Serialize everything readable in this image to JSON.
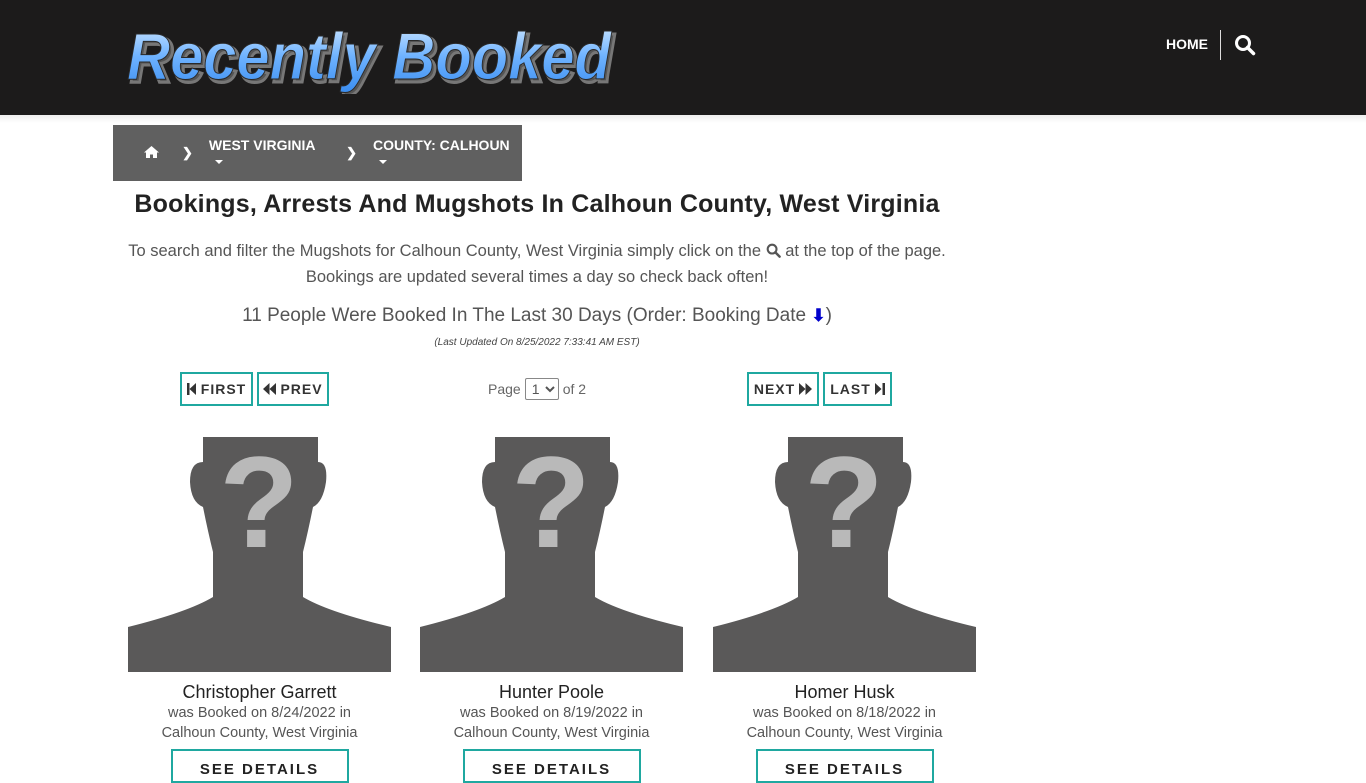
{
  "header": {
    "logo_text": "Recently Booked",
    "nav_home": "HOME",
    "search_icon": "search-icon"
  },
  "breadcrumb": {
    "home_icon": "home-icon",
    "state": "WEST VIRGINIA",
    "county": "COUNTY: CALHOUN"
  },
  "main": {
    "title": "Bookings, Arrests And Mugshots In Calhoun County, West Virginia",
    "intro_before": "To search and filter the Mugshots for Calhoun County, West Virginia simply click on the",
    "intro_after": "at the top of the page.",
    "intro_line2": "Bookings are updated several times a day so check back often!",
    "count_text": "11 People Were Booked In The Last 30 Days (Order: Booking Date",
    "count_close": ")",
    "last_updated": "(Last Updated On 8/25/2022 7:33:41 AM EST)"
  },
  "pager": {
    "first": "FIRST",
    "prev": "PREV",
    "page_label": "Page",
    "page_value": "1",
    "of_label": "of 2",
    "next": "NEXT",
    "last": "LAST"
  },
  "people": [
    {
      "name": "Christopher Garrett",
      "booked": "was Booked on 8/24/2022 in",
      "location": "Calhoun County, West Virginia",
      "button": "SEE DETAILS"
    },
    {
      "name": "Hunter Poole",
      "booked": "was Booked on 8/19/2022 in",
      "location": "Calhoun County, West Virginia",
      "button": "SEE DETAILS"
    },
    {
      "name": "Homer Husk",
      "booked": "was Booked on 8/18/2022 in",
      "location": "Calhoun County, West Virginia",
      "button": "SEE DETAILS"
    }
  ]
}
